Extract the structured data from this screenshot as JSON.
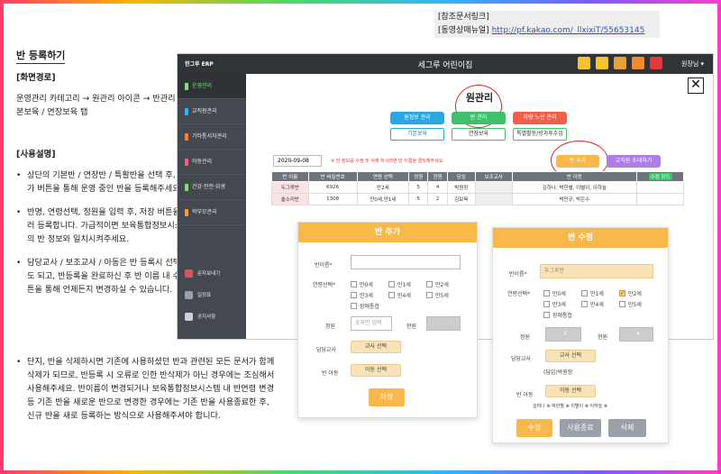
{
  "reference": {
    "line1": "[참조문서링크]",
    "line2_label": "[동영상매뉴얼]",
    "line2_url": "http://pf.kakao.com/_llxixiT/55653145"
  },
  "manual": {
    "title": "반 등록하기",
    "section_path_title": "[화면경로]",
    "path_text": "운영관리 카테고리 → 원관리 아이콘 → 반관리 → 기본보육 / 연장보육 탭",
    "section_usage_title": "[사용설명]",
    "bullets": [
      "상단의 기본반 / 연장반 / 특활반을 선택 후, 반 추가 버튼을 통해 운영 중인 반을 등록해주세요.",
      "반명, 연령선택, 정원을 입력 후, 저장 버튼을 눌러 등록합니다. 가급적이면 보육통합정보시스템의 반 정보와 일치시켜주세요.",
      "담당교사 / 보조교사 / 아동은 반 등록시 선택하셔도 되고, 반등록을 완료하신 후 반 이름 내 수정버튼을 통해 언제든지 변경하실 수 있습니다.",
      "단지, 반을 삭제하시면 기존에 사용하셨던 반과 관련된 모든 문서가 함께 삭제가 되므로, 반등록 시 오류로 인한 반삭제가 아닌 경우에는 조심해서 사용해주세요. 반이름이 변경되거나 보육통합정보시스템 내 반연령 변경 등 기존 반을 새로운 반으로 변경한 경우에는 기존 반을 사용종료한 후, 신규 반을 새로 등록하는 방식으로 사용해주셔야 합니다."
    ]
  },
  "app": {
    "logo": "한그루 ERP",
    "title": "세그루 어린이집",
    "user": "원장님 ▾",
    "sidebar": [
      "운영관리",
      "교직원관리",
      "기타통서자관리",
      "아동관리",
      "건강·안전·위생",
      "학부모관리"
    ],
    "sidebar_bottom": [
      "문자보내기",
      "일정표",
      "공지사항"
    ],
    "close": "✕",
    "content_title": "원관리",
    "tabs": [
      "원정보 관리",
      "반 관리",
      "차량 노선 관리"
    ],
    "subtabs": [
      "기본보육",
      "연장보육",
      "특별활동/방과후수업"
    ],
    "date": "2020-09-08",
    "notice": "※ 반 정보를 수정 및 삭제 하시려면 반 이름을 클릭해주세요.",
    "add_button": "반 추가",
    "teacher_button": "교직원 초대하기",
    "table_headers": [
      "반 이름",
      "반 비밀번호",
      "연령 선택",
      "정원",
      "현원",
      "담임",
      "보조교사",
      "반 아동",
      "수정 모드"
    ],
    "rows": [
      [
        "두그루반",
        "6926",
        "만2세",
        "5",
        "4",
        "박원장",
        "",
        "김하나, 박한별, 이별이, 이하늘"
      ],
      [
        "솔소리반",
        "1308",
        "만0세,만1세",
        "5",
        "2",
        "김보육",
        "",
        "박민규, 박은수"
      ]
    ]
  },
  "modal_add": {
    "title": "반 추가",
    "name_label": "반이름*",
    "name_value": "",
    "age_label": "연령선택*",
    "ages": [
      "만0세",
      "만1세",
      "만2세",
      "만3세",
      "만4세",
      "만5세",
      "장애통합"
    ],
    "capacity_label": "정원",
    "capacity_placeholder": "숫자만 입력",
    "current_label": "현원",
    "teacher_label": "담당교사",
    "teacher_btn": "교사 선택",
    "child_label": "반 아동",
    "child_btn": "아동 선택",
    "save": "저장"
  },
  "modal_edit": {
    "title": "반 수정",
    "name_label": "반이름*",
    "name_value": "두그루반",
    "age_label": "연령선택*",
    "ages": [
      "만0세",
      "만1세",
      "만2세",
      "만3세",
      "만4세",
      "만5세",
      "장애통합"
    ],
    "capacity_label": "정원",
    "capacity_value": "5",
    "current_label": "현원",
    "current_value": "4",
    "teacher_label": "담당교사",
    "teacher_btn": "교사 선택",
    "teacher_value": "(담임)박원장",
    "child_label": "반 아동",
    "child_btn": "아동 선택",
    "children": "김하나 ⊗  박한별 ⊗  이별이 ⊗  이하늘 ⊗",
    "edit": "수정",
    "end": "사용종료",
    "delete": "삭제"
  }
}
